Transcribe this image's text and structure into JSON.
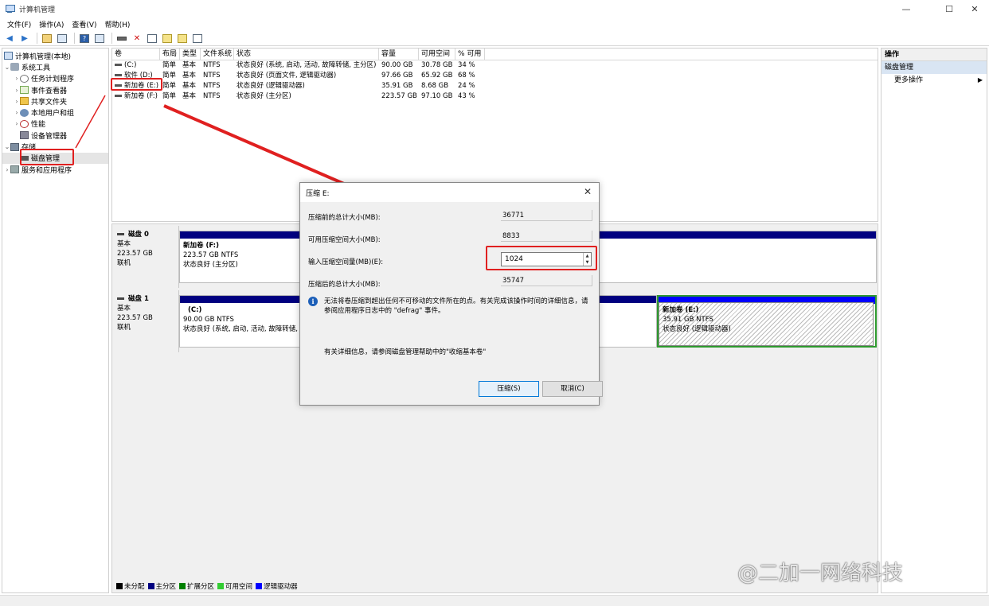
{
  "window": {
    "title": "计算机管理",
    "min": "—",
    "max": "☐",
    "close": "✕"
  },
  "menu": [
    "文件(F)",
    "操作(A)",
    "查看(V)",
    "帮助(H)"
  ],
  "tree": {
    "root": "计算机管理(本地)",
    "system_tools": "系统工具",
    "task_scheduler": "任务计划程序",
    "event_viewer": "事件查看器",
    "shared_folders": "共享文件夹",
    "local_users": "本地用户和组",
    "performance": "性能",
    "device_manager": "设备管理器",
    "storage": "存储",
    "disk_management": "磁盘管理",
    "services": "服务和应用程序"
  },
  "volumes": {
    "headers": [
      "卷",
      "布局",
      "类型",
      "文件系统",
      "状态",
      "容量",
      "可用空间",
      "% 可用"
    ],
    "rows": [
      [
        "(C:)",
        "简单",
        "基本",
        "NTFS",
        "状态良好 (系统, 启动, 活动, 故障转储, 主分区)",
        "90.00 GB",
        "30.78 GB",
        "34 %"
      ],
      [
        "软件 (D:)",
        "简单",
        "基本",
        "NTFS",
        "状态良好 (页面文件, 逻辑驱动器)",
        "97.66 GB",
        "65.92 GB",
        "68 %"
      ],
      [
        "新加卷 (E:)",
        "简单",
        "基本",
        "NTFS",
        "状态良好 (逻辑驱动器)",
        "35.91 GB",
        "8.68 GB",
        "24 %"
      ],
      [
        "新加卷 (F:)",
        "简单",
        "基本",
        "NTFS",
        "状态良好 (主分区)",
        "223.57 GB",
        "97.10 GB",
        "43 %"
      ]
    ]
  },
  "disks": [
    {
      "name": "磁盘 0",
      "type": "基本",
      "size": "223.57 GB",
      "state": "联机",
      "parts": [
        {
          "name": "新加卷  (F:)",
          "size": "223.57 GB NTFS",
          "status": "状态良好 (主分区)"
        }
      ]
    },
    {
      "name": "磁盘 1",
      "type": "基本",
      "size": "223.57 GB",
      "state": "联机",
      "parts": [
        {
          "name": "(C:)",
          "size": "90.00 GB NTFS",
          "status": "状态良好 (系统, 启动, 活动, 故障转储, 主"
        },
        {
          "name": "新加卷  (E:)",
          "size": "35.91 GB NTFS",
          "status": "状态良好 (逻辑驱动器)"
        }
      ]
    }
  ],
  "legend": [
    {
      "label": "未分配",
      "color": "#000000"
    },
    {
      "label": "主分区",
      "color": "#000080"
    },
    {
      "label": "扩展分区",
      "color": "#008000"
    },
    {
      "label": "可用空间",
      "color": "#33cc33"
    },
    {
      "label": "逻辑驱动器",
      "color": "#0000ff"
    }
  ],
  "actions": {
    "header": "操作",
    "section": "磁盘管理",
    "more": "更多操作"
  },
  "dialog": {
    "title": "压缩 E:",
    "total_before_label": "压缩前的总计大小(MB):",
    "total_before_value": "36771",
    "available_label": "可用压缩空间大小(MB):",
    "available_value": "8833",
    "input_label": "输入压缩空间量(MB)(E):",
    "input_value": "1024",
    "total_after_label": "压缩后的总计大小(MB):",
    "total_after_value": "35747",
    "info_text": "无法将卷压缩到超出任何不可移动的文件所在的点。有关完成该操作时间的详细信息，请参阅应用程序日志中的 \"defrag\" 事件。",
    "more_info": "有关详细信息，请参阅磁盘管理帮助中的\"收缩基本卷\"",
    "shrink_button": "压缩(S)",
    "cancel_button": "取消(C)"
  },
  "watermark": "@二加一网络科技"
}
